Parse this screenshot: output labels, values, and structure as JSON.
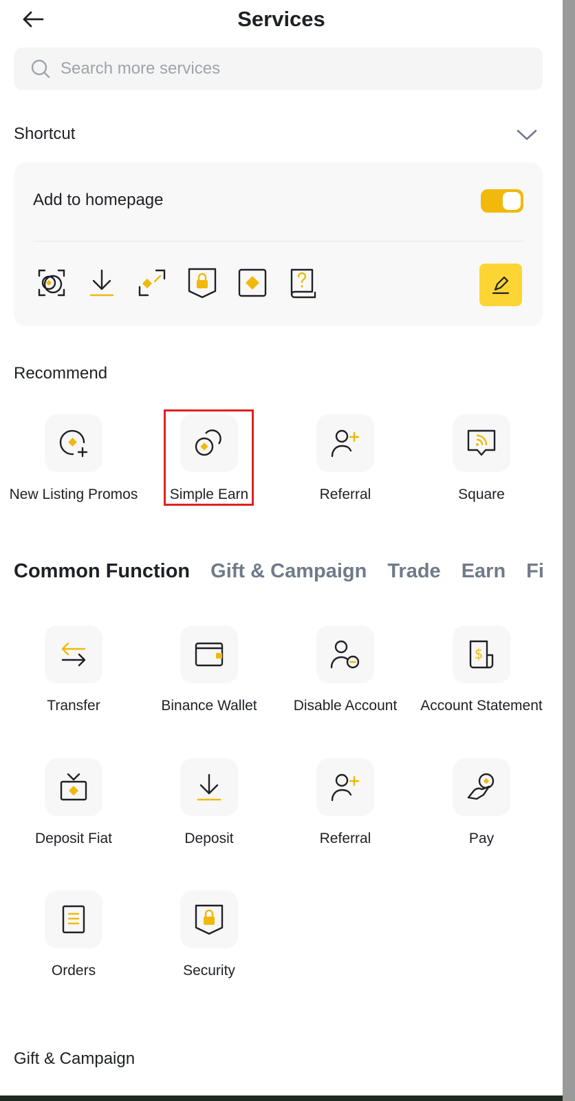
{
  "header": {
    "title": "Services"
  },
  "search": {
    "placeholder": "Search more services"
  },
  "shortcut": {
    "title": "Shortcut",
    "add_to_homepage_label": "Add to homepage",
    "toggle_on": true,
    "icons": [
      "convert-icon",
      "deposit-icon",
      "p2p-icon",
      "security-icon",
      "bnb-icon",
      "help-icon"
    ]
  },
  "recommend": {
    "title": "Recommend",
    "items": [
      {
        "label": "New Listing Promos",
        "icon": "new-listing-icon"
      },
      {
        "label": "Simple Earn",
        "icon": "simple-earn-icon"
      },
      {
        "label": "Referral",
        "icon": "referral-icon"
      },
      {
        "label": "Square",
        "icon": "square-icon"
      }
    ]
  },
  "tabs": [
    "Common Function",
    "Gift & Campaign",
    "Trade",
    "Earn",
    "Finance"
  ],
  "common": {
    "items": [
      {
        "label": "Transfer"
      },
      {
        "label": "Binance Wallet"
      },
      {
        "label": "Disable Account"
      },
      {
        "label": "Account Statement"
      },
      {
        "label": "Deposit Fiat"
      },
      {
        "label": "Deposit"
      },
      {
        "label": "Referral"
      },
      {
        "label": "Pay"
      },
      {
        "label": "Orders"
      },
      {
        "label": "Security"
      }
    ]
  },
  "gift_section": {
    "title": "Gift & Campaign"
  },
  "colors": {
    "accent": "#F0B90B",
    "accent_light": "#FCD535",
    "highlight": "#E02020"
  }
}
